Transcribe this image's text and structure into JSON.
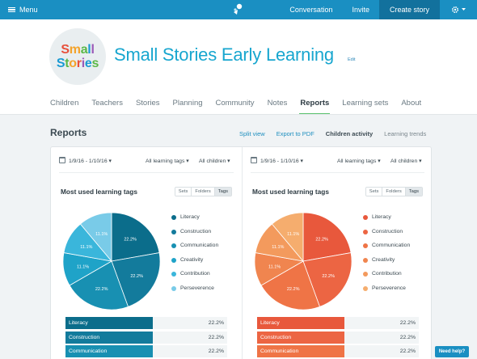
{
  "topbar": {
    "menu_label": "Menu",
    "nav": [
      {
        "label": "Conversation"
      },
      {
        "label": "Invite"
      },
      {
        "label": "Create story"
      }
    ],
    "colors": {
      "bar": "#1a8fc2",
      "active": "#12719d"
    }
  },
  "header": {
    "logo_line1": "Small",
    "logo_line2": "Stories",
    "school_name": "Small Stories Early Learning",
    "edit_label": "Edit"
  },
  "tabs": [
    "Children",
    "Teachers",
    "Stories",
    "Planning",
    "Community",
    "Notes",
    "Reports",
    "Learning sets",
    "About"
  ],
  "active_tab": "Reports",
  "reports": {
    "title": "Reports",
    "links": [
      "Split view",
      "Export to PDF",
      "Children activity",
      "Learning trends"
    ]
  },
  "panels": [
    {
      "date_range": "1/9/16 - 1/10/16",
      "tags_filter": "All learning tags",
      "children_filter": "All children",
      "chart_title": "Most used learning tags",
      "segments": [
        "Sets",
        "Folders",
        "Tags"
      ],
      "chart_data": {
        "type": "pie",
        "categories": [
          "Literacy",
          "Construction",
          "Communication",
          "Creativity",
          "Contribution",
          "Perseverence"
        ],
        "values": [
          22.2,
          22.2,
          22.2,
          11.1,
          11.1,
          11.1
        ],
        "slice_labels": [
          "22.2%",
          "22.2%",
          "22.2%",
          "11.1%",
          "11.1%",
          "11.1%"
        ],
        "colors": [
          "#0b6d8b",
          "#137b9c",
          "#1890b2",
          "#1fa3c8",
          "#3ab6db",
          "#79cbe8"
        ]
      },
      "bars": [
        {
          "label": "Literacy",
          "pct": "22.2%"
        },
        {
          "label": "Construction",
          "pct": "22.2%"
        },
        {
          "label": "Communication",
          "pct": "22.2%"
        }
      ]
    },
    {
      "date_range": "1/9/16 - 1/10/16",
      "tags_filter": "All learning tags",
      "children_filter": "All children",
      "chart_title": "Most used learning tags",
      "segments": [
        "Sets",
        "Folders",
        "Tags"
      ],
      "chart_data": {
        "type": "pie",
        "categories": [
          "Literacy",
          "Construction",
          "Communication",
          "Creativity",
          "Contribution",
          "Perseverence"
        ],
        "values": [
          22.2,
          22.2,
          22.2,
          11.1,
          11.1,
          11.1
        ],
        "slice_labels": [
          "22.2%",
          "22.2%",
          "22.2%",
          "11.1%",
          "11.1%",
          "11.1%"
        ],
        "colors": [
          "#e8583c",
          "#ec6543",
          "#ef7446",
          "#f0854f",
          "#f39a5d",
          "#f5ad6e"
        ]
      },
      "bars": [
        {
          "label": "Literacy",
          "pct": "22.2%"
        },
        {
          "label": "Construction",
          "pct": "22.2%"
        },
        {
          "label": "Communication",
          "pct": "22.2%"
        }
      ]
    }
  ],
  "need_help": "Need help?"
}
